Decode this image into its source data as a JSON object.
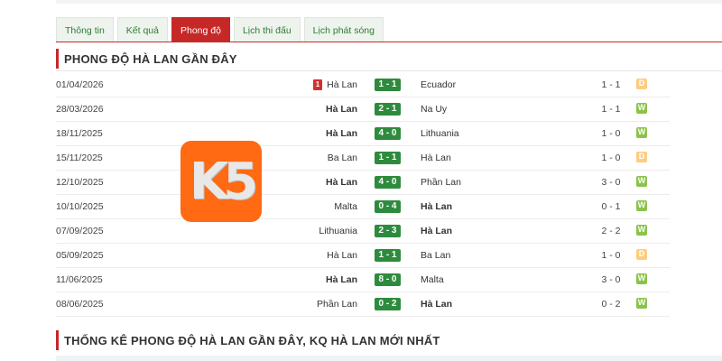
{
  "tabs": [
    {
      "label": "Thông tin",
      "active": false
    },
    {
      "label": "Kết quả",
      "active": false
    },
    {
      "label": "Phong độ",
      "active": true
    },
    {
      "label": "Lịch thi đấu",
      "active": false
    },
    {
      "label": "Lịch phát sóng",
      "active": false
    }
  ],
  "section1": {
    "title": "PHONG ĐỘ HÀ LAN GẦN ĐÂY"
  },
  "section2": {
    "title": "THỐNG KÊ PHONG ĐỘ HÀ LAN GẦN ĐÂY, KQ HÀ LAN MỚI NHẤT"
  },
  "logo": {
    "text": "K5",
    "color": "#ff6a13"
  },
  "colors": {
    "accent": "#c62828",
    "score": "#2e8b3e",
    "win": "#8bc34a",
    "draw": "#ffcc80"
  },
  "matches": [
    {
      "date": "01/04/2026",
      "home": "Hà Lan",
      "away": "Ecuador",
      "score": "1 - 1",
      "ht": "1 - 1",
      "result": "D",
      "card": "1",
      "home_bold": false,
      "away_bold": false
    },
    {
      "date": "28/03/2026",
      "home": "Hà Lan",
      "away": "Na Uy",
      "score": "2 - 1",
      "ht": "1 - 1",
      "result": "W",
      "card": "",
      "home_bold": true,
      "away_bold": false
    },
    {
      "date": "18/11/2025",
      "home": "Hà Lan",
      "away": "Lithuania",
      "score": "4 - 0",
      "ht": "1 - 0",
      "result": "W",
      "card": "",
      "home_bold": true,
      "away_bold": false
    },
    {
      "date": "15/11/2025",
      "home": "Ba Lan",
      "away": "Hà Lan",
      "score": "1 - 1",
      "ht": "1 - 0",
      "result": "D",
      "card": "",
      "home_bold": false,
      "away_bold": false
    },
    {
      "date": "12/10/2025",
      "home": "Hà Lan",
      "away": "Phần Lan",
      "score": "4 - 0",
      "ht": "3 - 0",
      "result": "W",
      "card": "",
      "home_bold": true,
      "away_bold": false
    },
    {
      "date": "10/10/2025",
      "home": "Malta",
      "away": "Hà Lan",
      "score": "0 - 4",
      "ht": "0 - 1",
      "result": "W",
      "card": "",
      "home_bold": false,
      "away_bold": true
    },
    {
      "date": "07/09/2025",
      "home": "Lithuania",
      "away": "Hà Lan",
      "score": "2 - 3",
      "ht": "2 - 2",
      "result": "W",
      "card": "",
      "home_bold": false,
      "away_bold": true
    },
    {
      "date": "05/09/2025",
      "home": "Hà Lan",
      "away": "Ba Lan",
      "score": "1 - 1",
      "ht": "1 - 0",
      "result": "D",
      "card": "",
      "home_bold": false,
      "away_bold": false
    },
    {
      "date": "11/06/2025",
      "home": "Hà Lan",
      "away": "Malta",
      "score": "8 - 0",
      "ht": "3 - 0",
      "result": "W",
      "card": "",
      "home_bold": true,
      "away_bold": false
    },
    {
      "date": "08/06/2025",
      "home": "Phần Lan",
      "away": "Hà Lan",
      "score": "0 - 2",
      "ht": "0 - 2",
      "result": "W",
      "card": "",
      "home_bold": false,
      "away_bold": true
    }
  ]
}
